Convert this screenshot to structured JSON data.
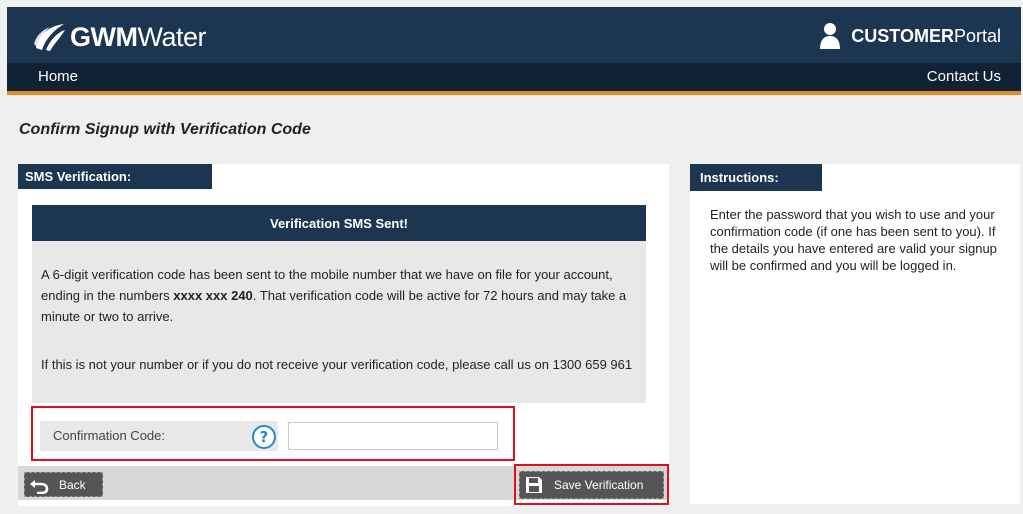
{
  "header": {
    "logo_bold": "GWM",
    "logo_regular": "Water",
    "portal_bold": "CUSTOMER",
    "portal_regular": "Portal"
  },
  "nav": {
    "home": "Home",
    "contact": "Contact Us"
  },
  "page": {
    "title": "Confirm Signup with Verification Code"
  },
  "sms_section": {
    "tab_label": "SMS Verification:",
    "box_heading": "Verification SMS Sent!",
    "message_part1": "A 6-digit verification code has been sent to the mobile number that we have on file for your account, ending in the numbers ",
    "masked_number": "xxxx xxx 240",
    "message_part2": ". That verification code will be active for 72 hours and may take a minute or two to arrive.",
    "help_message": "If this is not your number or if you do not receive your verification code, please call us on 1300 659 961"
  },
  "form": {
    "code_label": "Confirmation Code:",
    "code_value": "",
    "help_glyph": "?"
  },
  "actions": {
    "back_label": "Back",
    "save_label": "Save Verification"
  },
  "instructions": {
    "tab_label": "Instructions:",
    "text": "Enter the password that you wish to use and your confirmation code (if one has been sent to you). If the details you have entered are valid your signup will be confirmed and you will be logged in."
  },
  "colors": {
    "navy": "#1c3550",
    "nav_dark": "#112234",
    "accent_orange": "#e3892a",
    "highlight_red": "#e0101a",
    "help_blue": "#2a87c8"
  },
  "icons": {
    "logo": "gwm-leaf-logo-icon",
    "user": "user-icon",
    "help": "help-icon",
    "back": "undo-arrow-icon",
    "save": "floppy-disk-icon"
  }
}
